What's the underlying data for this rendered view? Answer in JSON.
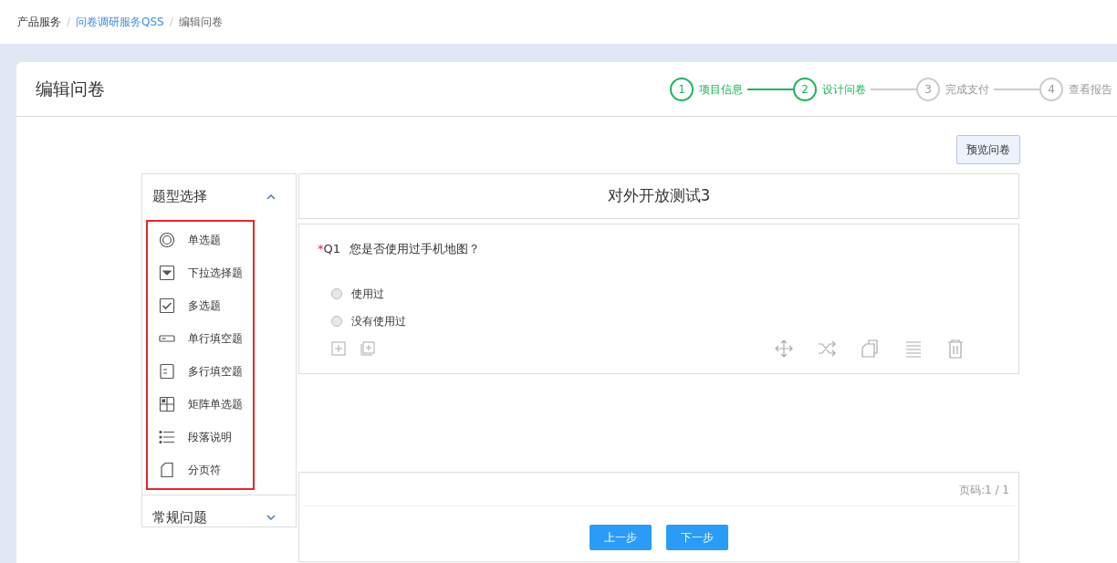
{
  "breadcrumb_separator": "/",
  "breadcrumb": [
    {
      "label": "产品服务",
      "kind": "plain"
    },
    {
      "label": "问卷调研服务QSS",
      "kind": "link"
    },
    {
      "label": "编辑问卷",
      "kind": "current"
    }
  ],
  "page_title": "编辑问卷",
  "steps": [
    {
      "number": "1",
      "label": "项目信息",
      "done": true
    },
    {
      "number": "2",
      "label": "设计问卷",
      "done": true
    },
    {
      "number": "3",
      "label": "完成支付",
      "done": false
    },
    {
      "number": "4",
      "label": "查看报告",
      "done": false
    }
  ],
  "preview_button": "预览问卷",
  "sidebar": {
    "sections": [
      {
        "title": "题型选择",
        "expanded": true,
        "items": [
          {
            "label": "单选题",
            "kind": "radio"
          },
          {
            "label": "下拉选择题",
            "kind": "dropdown"
          },
          {
            "label": "多选题",
            "kind": "checkbox"
          },
          {
            "label": "单行填空题",
            "kind": "line"
          },
          {
            "label": "多行填空题",
            "kind": "multiline"
          },
          {
            "label": "矩阵单选题",
            "kind": "matrix"
          },
          {
            "label": "段落说明",
            "kind": "paragraph"
          },
          {
            "label": "分页符",
            "kind": "pagebreak"
          }
        ]
      },
      {
        "title": "常规问题",
        "expanded": false
      }
    ]
  },
  "survey_title": "对外开放测试3",
  "questions": [
    {
      "required": true,
      "required_mark": "*",
      "number": "Q1",
      "text": "您是否使用过手机地图？",
      "options": [
        {
          "label": "使用过",
          "selected": false
        },
        {
          "label": "没有使用过",
          "selected": false
        }
      ]
    }
  ],
  "page_indicator": "页码:1 / 1",
  "nav_buttons": [
    "上一步",
    "下一步"
  ]
}
